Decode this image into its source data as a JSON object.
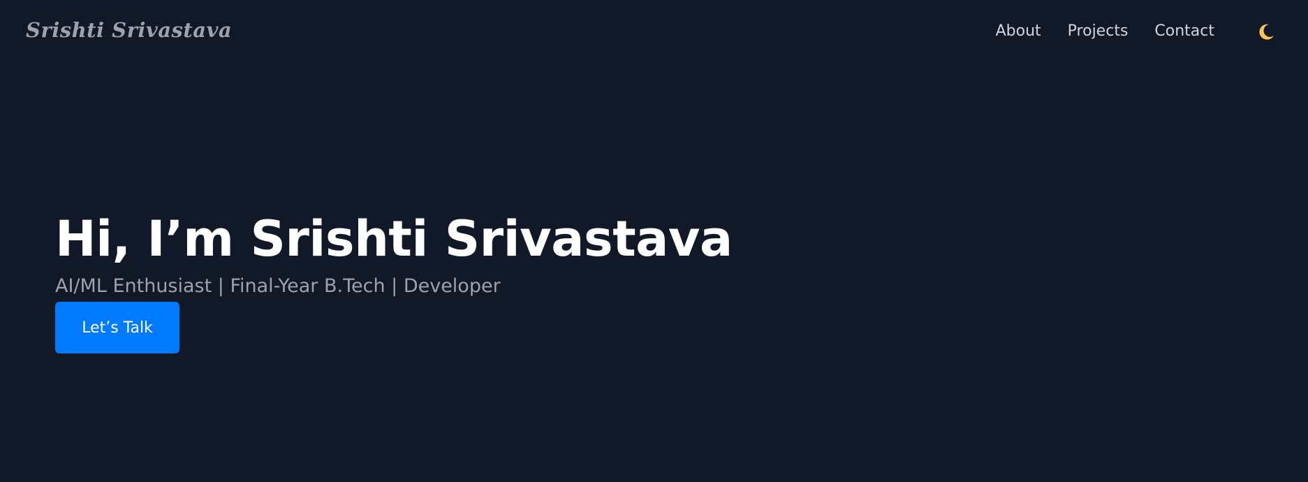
{
  "nav": {
    "brand": "Srishti Srivastava",
    "links": [
      {
        "label": "About"
      },
      {
        "label": "Projects"
      },
      {
        "label": "Contact"
      }
    ],
    "theme_toggle_icon": "moon-icon"
  },
  "hero": {
    "title": "Hi, I’m Srishti Srivastava",
    "subtitle": "AI/ML Enthusiast | Final-Year B.Tech | Developer",
    "cta_label": "Let’s Talk"
  },
  "colors": {
    "background": "#111827",
    "accent": "#007bff",
    "muted_text": "#9ca3af",
    "nav_text": "#d1d5db",
    "moon": "#f6c358"
  }
}
